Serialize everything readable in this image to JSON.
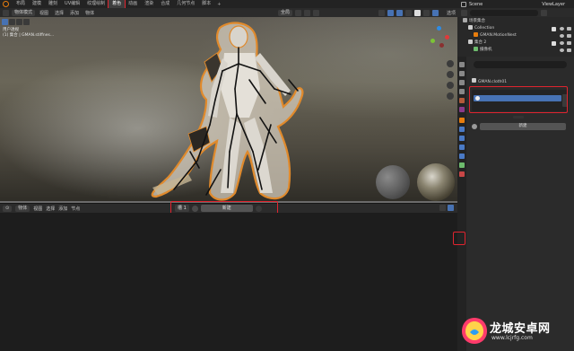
{
  "topbar": {
    "tabs": [
      "布局",
      "建模",
      "雕刻",
      "UV编辑",
      "纹理绘制",
      "着色",
      "动画",
      "渲染",
      "合成",
      "几何节点",
      "脚本"
    ],
    "active_tab": "着色",
    "plus": "+"
  },
  "viewport_header": {
    "editor_mode": "物体模式",
    "menus": [
      "视图",
      "选择",
      "添加",
      "物体"
    ],
    "transform": "全局",
    "overlay_label": "选项"
  },
  "viewport": {
    "overlay_line1": "用户透视",
    "overlay_line2": "(1) 集合 | GMAN.stiffnes..."
  },
  "shader_editor": {
    "editor_type": "物体",
    "menus": [
      "视图",
      "选择",
      "添加",
      "节点"
    ],
    "slot": "槽 1",
    "new_button": "新建"
  },
  "outliner": {
    "scene": "Scene",
    "view_layer": "ViewLayer",
    "rows": [
      {
        "label": "场景集合"
      },
      {
        "label": "Collection"
      },
      {
        "label": "GMAN.MotionNest"
      },
      {
        "label": "集合 2"
      },
      {
        "label": "摄像机"
      }
    ]
  },
  "properties": {
    "search_placeholder": "",
    "object_name": "GMAN.cloth01",
    "new_button": "新建",
    "dots": "…"
  },
  "watermark": {
    "title": "龙城安卓网",
    "url": "www.lcjrfg.com"
  },
  "colors": {
    "accent": "#4772b3",
    "highlight_box": "#e0242f",
    "blender_orange": "#e87d0d"
  }
}
